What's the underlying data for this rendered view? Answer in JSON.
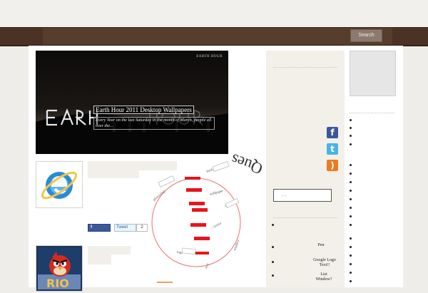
{
  "nav": {
    "search_label": "Search"
  },
  "slider": {
    "tag": "EARTH HOUR",
    "title": "Earth Hour 2011 Desktop Wallpapers",
    "excerpt": "Every Year on the last Saturday in the month of March, people all over the..."
  },
  "post1": {
    "share": {
      "facebook_icon": "f",
      "tweet_label": "Tweet",
      "count": "2"
    }
  },
  "tag_wheel": {
    "big_word": "Ques",
    "words": [
      "background",
      "tutorial",
      "photoshop",
      "wallpaper",
      "design",
      "logo",
      "vector",
      "text",
      "window"
    ]
  },
  "sidebar": {
    "input_text": ". .",
    "links": [
      "Pen",
      "Google Logo Text!!",
      "List Window?"
    ]
  },
  "social": {
    "facebook": "f",
    "twitter": "t",
    "rss": ")"
  },
  "colors": {
    "nav_bg": "#4a3325",
    "sidebar_bg": "#f3f0ea",
    "wheel_accent": "#e8141b",
    "facebook": "#3b5998",
    "twitter": "#4ab3e6",
    "rss": "#ec7a1f"
  }
}
